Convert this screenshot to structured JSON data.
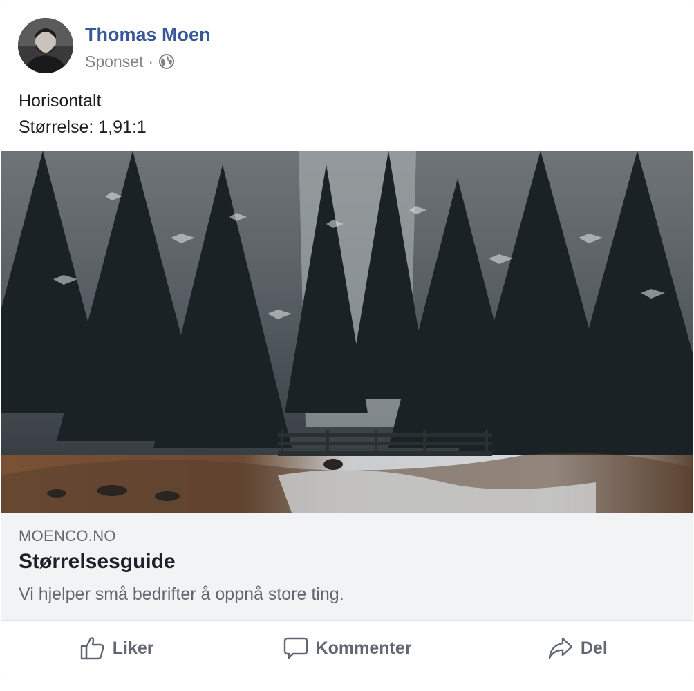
{
  "post": {
    "author": "Thomas Moen",
    "sponsored": "Sponset",
    "separator": "·",
    "privacy_icon": "globe-icon",
    "text_lines": [
      "Horisontalt",
      "Størrelse: 1,91:1"
    ],
    "image_icon": "forest-photo"
  },
  "link": {
    "domain": "MOENCO.NO",
    "title": "Størrelsesguide",
    "description": "Vi hjelper små bedrifter å oppnå store ting."
  },
  "actions": {
    "like": {
      "label": "Liker",
      "icon": "thumbs-up-icon"
    },
    "comment": {
      "label": "Kommenter",
      "icon": "comment-icon"
    },
    "share": {
      "label": "Del",
      "icon": "share-arrow-icon"
    }
  },
  "colors": {
    "author": "#385898",
    "secondary_text": "#606770",
    "link_box_bg": "#f2f3f5",
    "border": "#dddfe2"
  }
}
